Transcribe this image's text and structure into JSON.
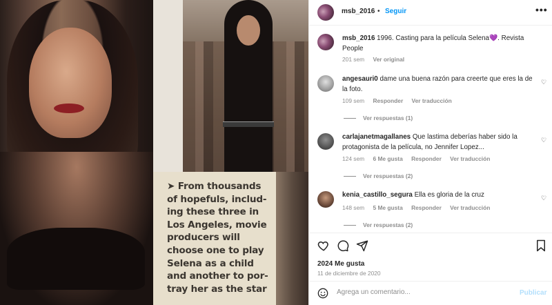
{
  "media": {
    "clipping_text": "➤ From thousands\nof hopefuls, includ-\ning these three in\nLos Angeles, movie\nproducers will\nchoose one to play\nSelena as a child\nand another to por-\ntray her as the star"
  },
  "header": {
    "username": "msb_2016",
    "separator": "•",
    "follow_label": "Seguir",
    "more_icon": "more-horizontal-icon"
  },
  "caption": {
    "username": "msb_2016",
    "text": "1996. Casting para la película Selena💜. Revista People",
    "time": "201 sem",
    "translate_label": "Ver original"
  },
  "comments": [
    {
      "username": "angesauri0",
      "text": "dame una buena razón para creerte que eres la de la foto.",
      "time": "109 sem",
      "likes": "",
      "reply_label": "Responder",
      "translate_label": "Ver traducción",
      "replies_label": "Ver respuestas (1)"
    },
    {
      "username": "carlajanetmagallanes",
      "text": "Que lastima deberías haber sido la protagonista de la película, no Jennifer Lopez...",
      "time": "124 sem",
      "likes": "6 Me gusta",
      "reply_label": "Responder",
      "translate_label": "Ver traducción",
      "replies_label": "Ver respuestas (2)"
    },
    {
      "username": "kenia_castillo_segura",
      "text": "Ella es gloria de la cruz",
      "time": "148 sem",
      "likes": "5 Me gusta",
      "reply_label": "Responder",
      "translate_label": "Ver traducción",
      "replies_label": "Ver respuestas (2)"
    }
  ],
  "actions": {
    "like_icon": "heart-icon",
    "comment_icon": "comment-icon",
    "share_icon": "send-icon",
    "save_icon": "bookmark-icon",
    "likes_count": "2024 Me gusta",
    "date": "11 de diciembre de 2020"
  },
  "composer": {
    "placeholder": "Agrega un comentario...",
    "publish_label": "Publicar"
  },
  "colors": {
    "accent": "#0095f6",
    "publish_disabled": "#b2dffc",
    "muted": "#8e8e8e"
  }
}
